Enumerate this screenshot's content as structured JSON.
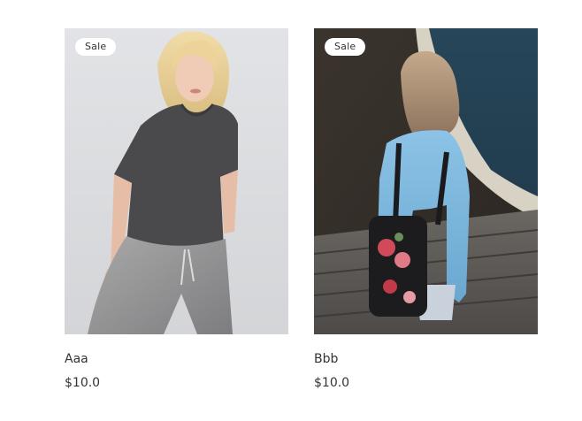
{
  "products": [
    {
      "badge": "Sale",
      "title": "Aaa",
      "price": "$10.0",
      "image_description": "woman in dark grey t-shirt and grey jogger pants"
    },
    {
      "badge": "Sale",
      "title": "Bbb",
      "price": "$10.0",
      "image_description": "woman with floral backpack sitting on wooden deck overlooking sea"
    }
  ],
  "colors": {
    "text": "#333333",
    "badge_bg": "#ffffff",
    "page_bg": "#ffffff"
  }
}
